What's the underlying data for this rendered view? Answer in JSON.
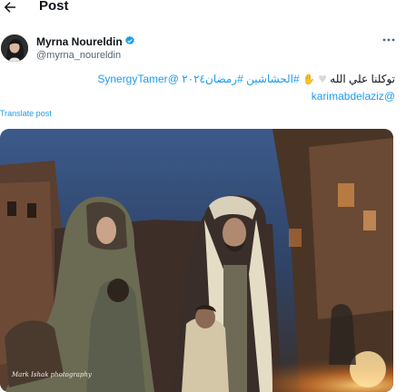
{
  "header": {
    "title": "Post"
  },
  "author": {
    "name": "Myrna Noureldin",
    "handle": "@myrna_noureldin"
  },
  "tweet": {
    "line1_text": "توكلنا علي الله",
    "line1_hashtags": "#الحشاشين #رمضان٢٠٢٤",
    "line1_mention": "@SynergyTamer",
    "line2_mention": "@karimabdelaziz",
    "emojis": {
      "heart": "white-heart-icon",
      "hands": "folded-hands-icon"
    }
  },
  "translate_label": "Translate post",
  "media": {
    "watermark": "Mark Ishak photography"
  },
  "colors": {
    "link": "#1d9bf0",
    "verified": "#1d9bf0",
    "muted": "#536471"
  }
}
